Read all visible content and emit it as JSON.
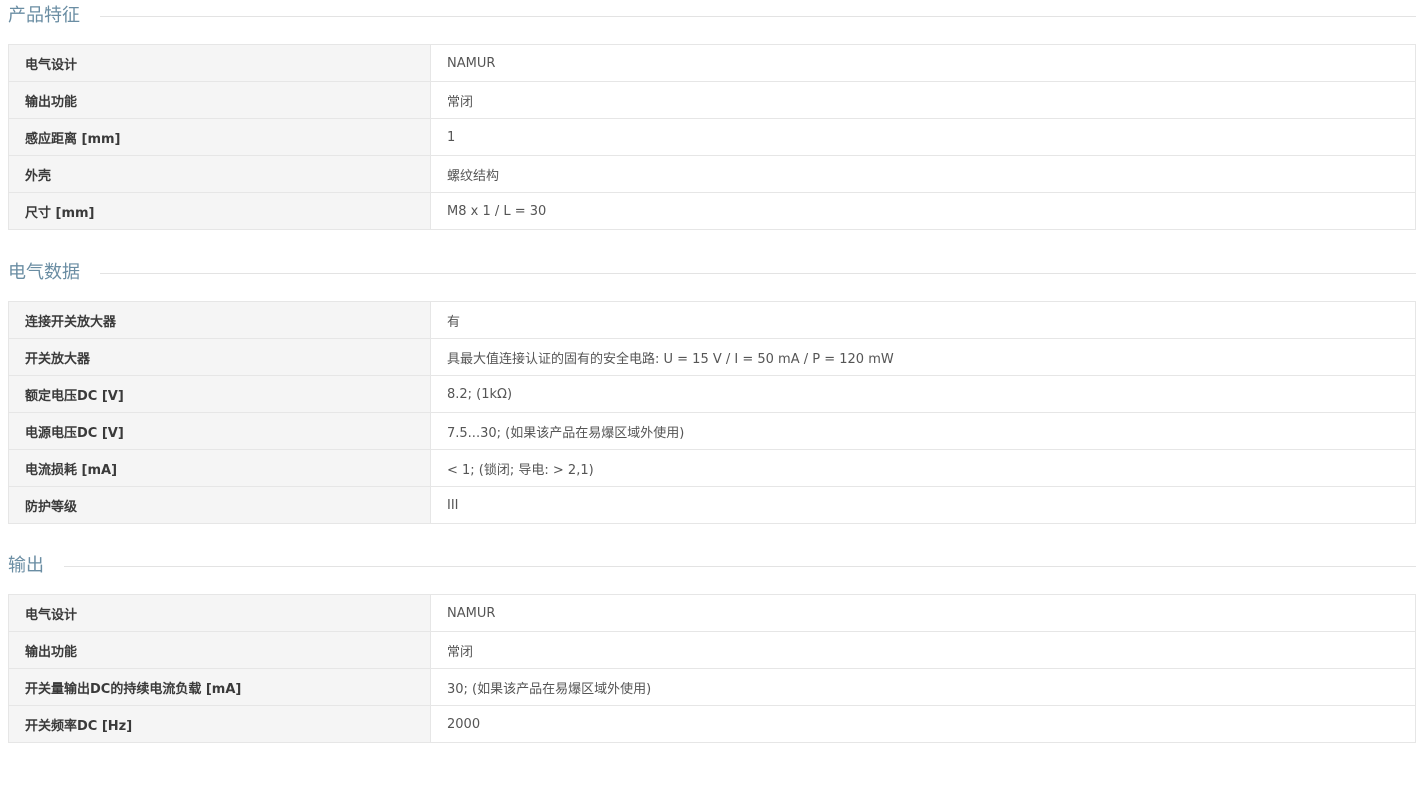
{
  "sections": [
    {
      "title": "产品特征",
      "rows": [
        {
          "label": "电气设计",
          "value": "NAMUR"
        },
        {
          "label": "输出功能",
          "value": "常闭"
        },
        {
          "label": "感应距离 [mm]",
          "value": "1"
        },
        {
          "label": "外壳",
          "value": "螺纹结构"
        },
        {
          "label": "尺寸 [mm]",
          "value": "M8 x 1 / L = 30"
        }
      ]
    },
    {
      "title": "电气数据",
      "rows": [
        {
          "label": "连接开关放大器",
          "value": "有"
        },
        {
          "label": "开关放大器",
          "value": "具最大值连接认证的固有的安全电路: U = 15 V / I = 50 mA / P = 120 mW"
        },
        {
          "label": "额定电压DC [V]",
          "value": "8.2; (1kΩ)"
        },
        {
          "label": "电源电压DC [V]",
          "value": "7.5...30; (如果该产品在易爆区域外使用)"
        },
        {
          "label": "电流损耗 [mA]",
          "value": "< 1; (锁闭; 导电: > 2,1)"
        },
        {
          "label": "防护等级",
          "value": "III"
        }
      ]
    },
    {
      "title": "输出",
      "rows": [
        {
          "label": "电气设计",
          "value": "NAMUR"
        },
        {
          "label": "输出功能",
          "value": "常闭"
        },
        {
          "label": "开关量输出DC的持续电流负载 [mA]",
          "value": "30; (如果该产品在易爆区域外使用)"
        },
        {
          "label": "开关频率DC [Hz]",
          "value": "2000"
        }
      ]
    }
  ]
}
